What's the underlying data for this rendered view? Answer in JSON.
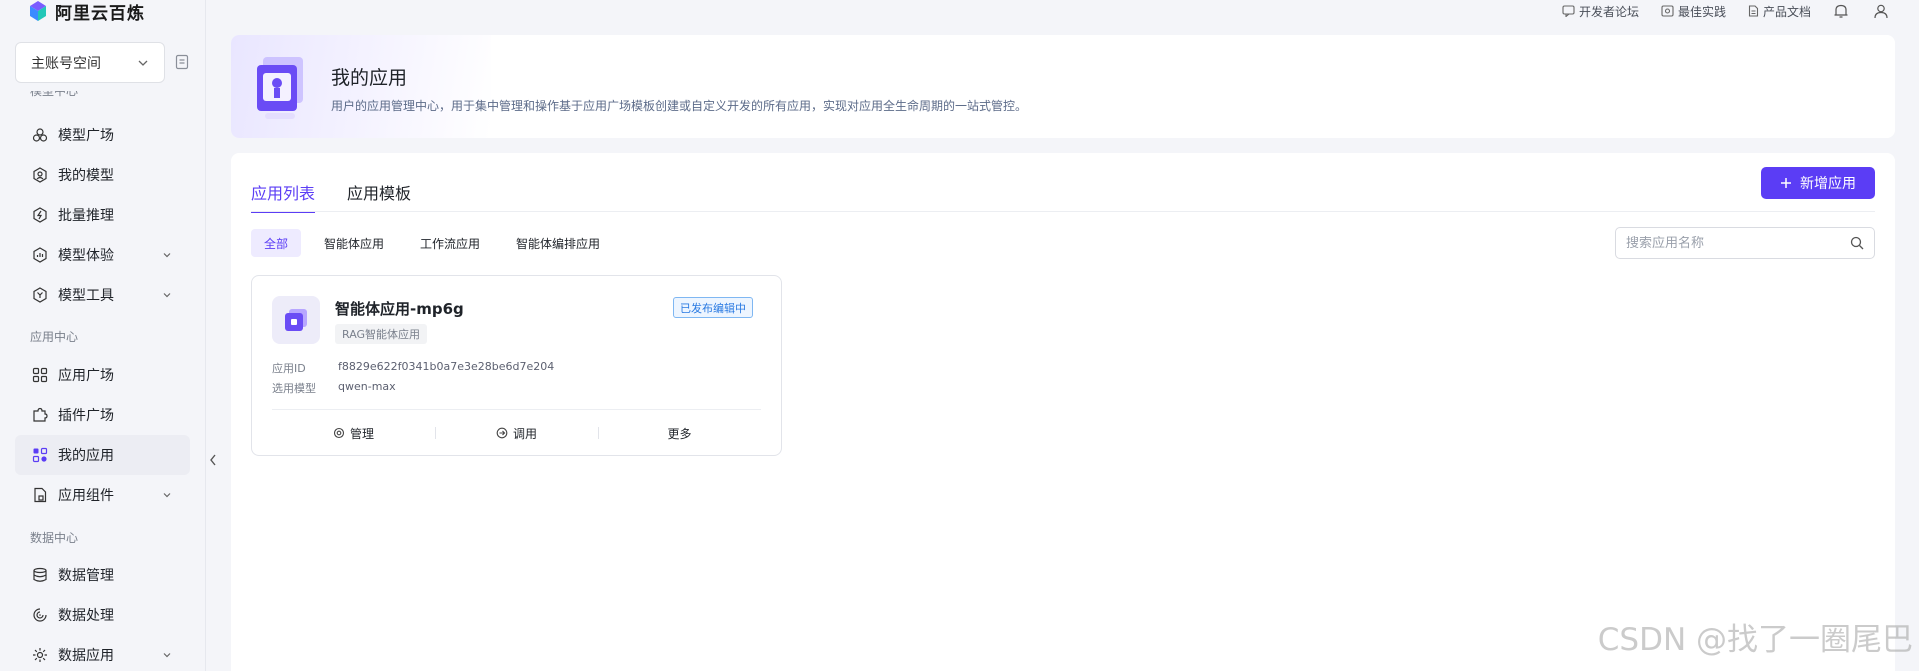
{
  "brand": {
    "name": "阿里云百炼"
  },
  "sidebar": {
    "workspace": "主账号空间",
    "truncated_label": "模型中心",
    "items": [
      {
        "label": "模型广场",
        "icon": "model-square-icon"
      },
      {
        "label": "我的模型",
        "icon": "my-model-icon"
      },
      {
        "label": "批量推理",
        "icon": "batch-inference-icon"
      },
      {
        "label": "模型体验",
        "icon": "model-experience-icon"
      },
      {
        "label": "模型工具",
        "icon": "model-tools-icon"
      },
      {
        "label": "应用广场",
        "icon": "app-square-icon"
      },
      {
        "label": "插件广场",
        "icon": "plugin-square-icon"
      },
      {
        "label": "我的应用",
        "icon": "my-apps-icon"
      },
      {
        "label": "应用组件",
        "icon": "app-components-icon"
      },
      {
        "label": "数据管理",
        "icon": "data-management-icon"
      },
      {
        "label": "数据处理",
        "icon": "data-processing-icon"
      },
      {
        "label": "数据应用",
        "icon": "data-apps-icon"
      }
    ],
    "sections": {
      "app_center": "应用中心",
      "data_center": "数据中心"
    }
  },
  "topbar": {
    "links": [
      {
        "label": "开发者论坛",
        "icon": "forum-icon"
      },
      {
        "label": "最佳实践",
        "icon": "best-practice-icon"
      },
      {
        "label": "产品文档",
        "icon": "docs-icon"
      }
    ]
  },
  "header": {
    "title": "我的应用",
    "description": "用户的应用管理中心，用于集中管理和操作基于应用广场模板创建或自定义开发的所有应用，实现对应用全生命周期的一站式管控。"
  },
  "main": {
    "tabs": [
      {
        "label": "应用列表",
        "active": true
      },
      {
        "label": "应用模板",
        "active": false
      }
    ],
    "new_button": "新增应用",
    "filters": [
      "全部",
      "智能体应用",
      "工作流应用",
      "智能体编排应用"
    ],
    "search_placeholder": "搜索应用名称"
  },
  "apps": [
    {
      "name": "智能体应用-mp6g",
      "type": "RAG智能体应用",
      "status": "已发布编辑中",
      "id_label": "应用ID",
      "id": "f8829e622f0341b0a7e3e28be6d7e204",
      "model_label": "选用模型",
      "model": "qwen-max",
      "actions": [
        "管理",
        "调用",
        "更多"
      ]
    }
  ],
  "watermark": "CSDN @找了一圈尾巴",
  "colors": {
    "accent": "#5b3df5",
    "status_blue": "#2a7ae2",
    "background": "#f4f5f9"
  }
}
